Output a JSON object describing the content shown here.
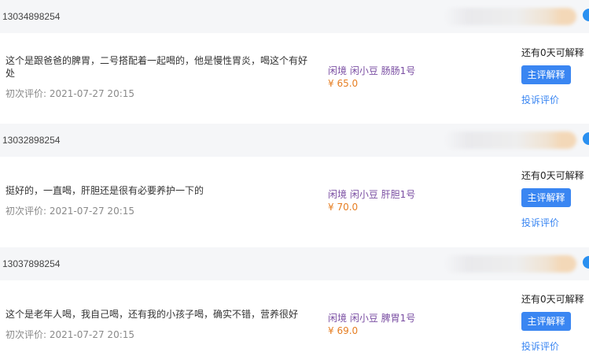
{
  "orders": [
    {
      "phone": "13034898254",
      "comment": "这个是跟爸爸的脾胃，二号搭配着一起喝的，他是慢性胃炎，喝这个有好处",
      "first_eval_label": "初次评价:",
      "first_eval_time": "2021-07-27 20:15",
      "product": "闲境 闲小豆 肠肠1号",
      "price": "¥ 65.0",
      "remaining": "还有0天可解释",
      "explain_label": "主评解释",
      "complain_label": "投诉评价"
    },
    {
      "phone": "13032898254",
      "comment": "挺好的，一直喝，肝胆还是很有必要养护一下的",
      "first_eval_label": "初次评价:",
      "first_eval_time": "2021-07-27 20:15",
      "product": "闲境 闲小豆 肝胆1号",
      "price": "¥ 70.0",
      "remaining": "还有0天可解释",
      "explain_label": "主评解释",
      "complain_label": "投诉评价"
    },
    {
      "phone": "13037898254",
      "comment": "这个是老年人喝，我自己喝，还有我的小孩子喝，确实不错，营养很好",
      "first_eval_label": "初次评价:",
      "first_eval_time": "2021-07-27 20:15",
      "product": "闲境 闲小豆 脾胃1号",
      "price": "¥ 69.0",
      "remaining": "还有0天可解释",
      "explain_label": "主评解释",
      "complain_label": "投诉评价"
    }
  ],
  "colors": {
    "header_bg": "#f5f6f8",
    "accent": "#3a86f2",
    "product": "#7b4fa3",
    "price": "#e67e22",
    "muted": "#8a8a8a"
  }
}
